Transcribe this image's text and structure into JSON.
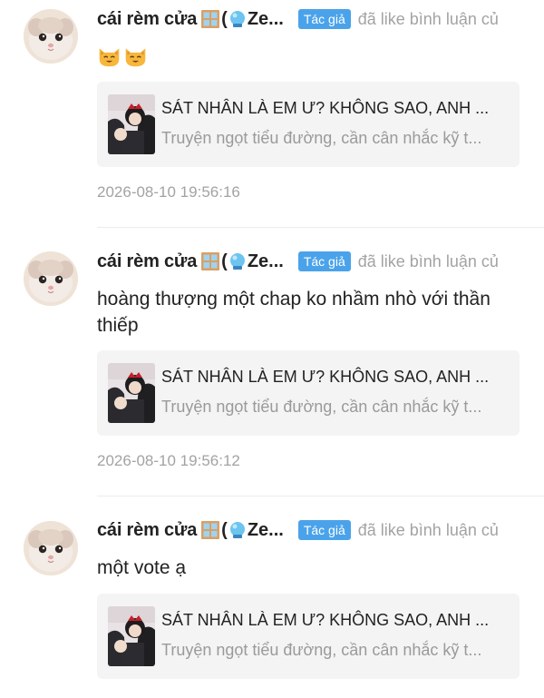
{
  "comments": [
    {
      "username": "cái rèm cửa",
      "name_tail": "Ze...",
      "badge": "Tác giả",
      "action": "đã like bình luận củ",
      "content": "",
      "content_emoji": [
        "smiling-cat-icon",
        "smiling-cat-icon"
      ],
      "card_title": "SÁT NHÂN LÀ EM Ư? KHÔNG SAO, ANH ...",
      "card_subtitle": "Truyện ngọt tiểu đường, cần cân nhắc kỹ t...",
      "timestamp": "2026-08-10 19:56:16"
    },
    {
      "username": "cái rèm cửa",
      "name_tail": "Ze...",
      "badge": "Tác giả",
      "action": "đã like bình luận củ",
      "content": "hoàng thượng một chap ko nhầm nhò với thần thiếp",
      "card_title": "SÁT NHÂN LÀ EM Ư? KHÔNG SAO, ANH ...",
      "card_subtitle": "Truyện ngọt tiểu đường, cần cân nhắc kỹ t...",
      "timestamp": "2026-08-10 19:56:12"
    },
    {
      "username": "cái rèm cửa",
      "name_tail": "Ze...",
      "badge": "Tác giả",
      "action": "đã like bình luận củ",
      "content": "một vote ạ",
      "card_title": "SÁT NHÂN LÀ EM Ư? KHÔNG SAO, ANH ...",
      "card_subtitle": "Truyện ngọt tiểu đường, cần cân nhắc kỹ t...",
      "timestamp": ""
    }
  ],
  "colors": {
    "badge_bg": "#4aa3ea",
    "muted_text": "#a3a3a3",
    "card_bg": "#f4f4f4"
  }
}
